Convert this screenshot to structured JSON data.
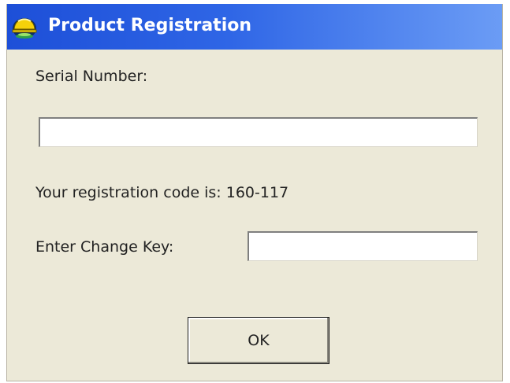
{
  "window": {
    "title": "Product Registration",
    "icon": "hardhat-app-icon"
  },
  "form": {
    "serial_label": "Serial Number:",
    "serial_value": "",
    "registration_text": "Your registration code is: 160-117",
    "change_key_label": "Enter Change Key:",
    "change_key_value": ""
  },
  "buttons": {
    "ok_label": "OK"
  },
  "colors": {
    "titlebar_start": "#1d4fd8",
    "titlebar_end": "#6b9cf5",
    "dialog_background": "#ece9d8"
  }
}
